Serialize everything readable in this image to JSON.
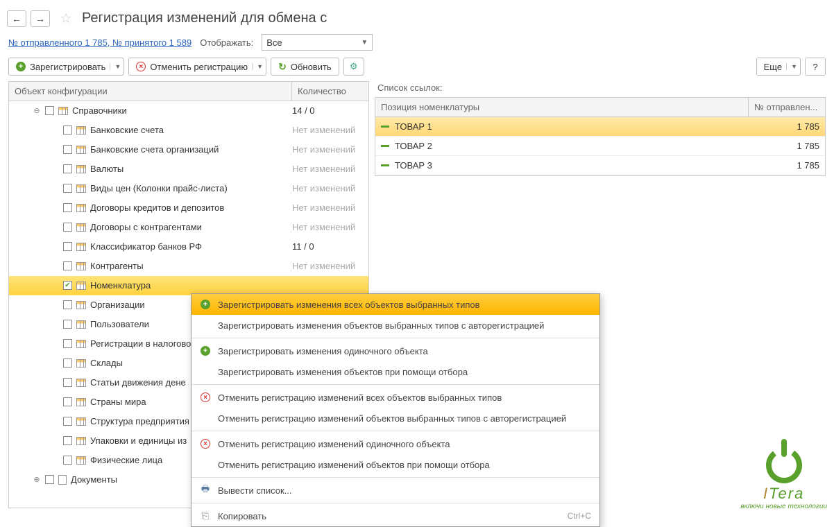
{
  "title": "Регистрация изменений для обмена с",
  "sent_received_link": "№ отправленного 1 785, № принятого 1 589",
  "display_label": "Отображать:",
  "display_value": "Все",
  "toolbar": {
    "register_label": "Зарегистрировать",
    "cancel_label": "Отменить регистрацию",
    "refresh_label": "Обновить",
    "more_label": "Еще"
  },
  "left": {
    "col_object": "Объект конфигурации",
    "col_count": "Количество",
    "root_label": "Справочники",
    "root_count": "14 / 0",
    "no_changes": "Нет изменений",
    "items": [
      {
        "label": "Банковские счета",
        "count": "Нет изменений"
      },
      {
        "label": "Банковские счета организаций",
        "count": "Нет изменений"
      },
      {
        "label": "Валюты",
        "count": "Нет изменений"
      },
      {
        "label": "Виды цен (Колонки прайс-листа)",
        "count": "Нет изменений"
      },
      {
        "label": "Договоры кредитов и депозитов",
        "count": "Нет изменений"
      },
      {
        "label": "Договоры с контрагентами",
        "count": "Нет изменений"
      },
      {
        "label": "Классификатор банков РФ",
        "count": "11 / 0"
      },
      {
        "label": "Контрагенты",
        "count": "Нет изменений"
      },
      {
        "label": "Номенклатура",
        "count": "",
        "selected": true,
        "checked": true
      },
      {
        "label": "Организации",
        "count": ""
      },
      {
        "label": "Пользователи",
        "count": ""
      },
      {
        "label": "Регистрации в налогово",
        "count": ""
      },
      {
        "label": "Склады",
        "count": ""
      },
      {
        "label": "Статьи движения дене",
        "count": ""
      },
      {
        "label": "Страны мира",
        "count": ""
      },
      {
        "label": "Структура предприятия",
        "count": ""
      },
      {
        "label": "Упаковки и единицы из",
        "count": ""
      },
      {
        "label": "Физические лица",
        "count": ""
      }
    ],
    "documents_label": "Документы"
  },
  "right": {
    "title": "Список ссылок:",
    "col_position": "Позиция номенклатуры",
    "col_sent": "№ отправлен...",
    "rows": [
      {
        "name": "ТОВАР 1",
        "num": "1 785",
        "sel": true
      },
      {
        "name": "ТОВАР 2",
        "num": "1 785"
      },
      {
        "name": "ТОВАР 3",
        "num": "1 785"
      }
    ]
  },
  "context_menu": [
    {
      "text": "Зарегистрировать изменения всех объектов выбранных типов",
      "icon": "plus",
      "hl": true
    },
    {
      "text": "Зарегистрировать изменения объектов выбранных типов с авторегистрацией"
    },
    {
      "sep": true
    },
    {
      "text": "Зарегистрировать изменения одиночного объекта",
      "icon": "plus"
    },
    {
      "text": "Зарегистрировать изменения объектов при помощи отбора"
    },
    {
      "sep": true
    },
    {
      "text": "Отменить регистрацию изменений всех объектов выбранных типов",
      "icon": "x"
    },
    {
      "text": "Отменить регистрацию изменений объектов выбранных типов с авторегистрацией"
    },
    {
      "sep": true
    },
    {
      "text": "Отменить регистрацию изменений одиночного объекта",
      "icon": "x"
    },
    {
      "text": "Отменить регистрацию изменений объектов при помощи отбора"
    },
    {
      "sep": true
    },
    {
      "text": "Вывести список...",
      "icon": "print"
    },
    {
      "sep": true
    },
    {
      "text": "Копировать",
      "icon": "copy",
      "shortcut": "Ctrl+C"
    }
  ],
  "logo": {
    "brand": "ITera",
    "tagline": "включи новые технологии"
  }
}
